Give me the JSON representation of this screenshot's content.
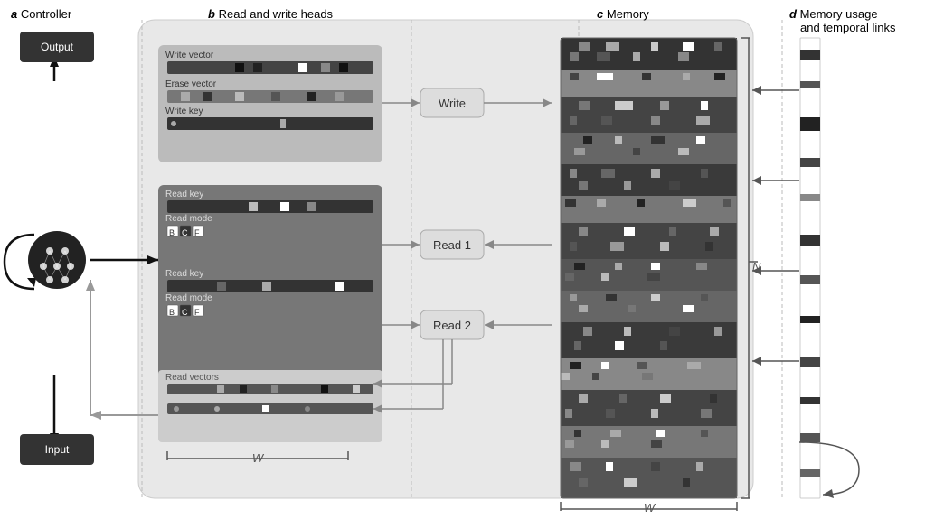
{
  "sections": {
    "a": {
      "label": "a",
      "title": "Controller",
      "output": "Output",
      "input": "Input"
    },
    "b": {
      "label": "b",
      "title": "Read and write heads",
      "write_head": {
        "label": "Write vector",
        "erase_label": "Erase vector",
        "key_label": "Write key"
      },
      "read_head1": {
        "key_label": "Read key",
        "mode_label": "Read mode",
        "modes": [
          "B",
          "C",
          "F"
        ]
      },
      "read_head2": {
        "key_label": "Read key",
        "mode_label": "Read mode",
        "modes": [
          "B",
          "C",
          "F"
        ]
      },
      "read_vectors_label": "Read vectors",
      "write_btn": "Write",
      "read1_btn": "Read 1",
      "read2_btn": "Read 2",
      "w_label": "W"
    },
    "c": {
      "label": "c",
      "title": "Memory",
      "w_label": "W",
      "n_label": "N"
    },
    "d": {
      "label": "d",
      "title": "Memory usage",
      "subtitle": "and temporal links"
    }
  }
}
